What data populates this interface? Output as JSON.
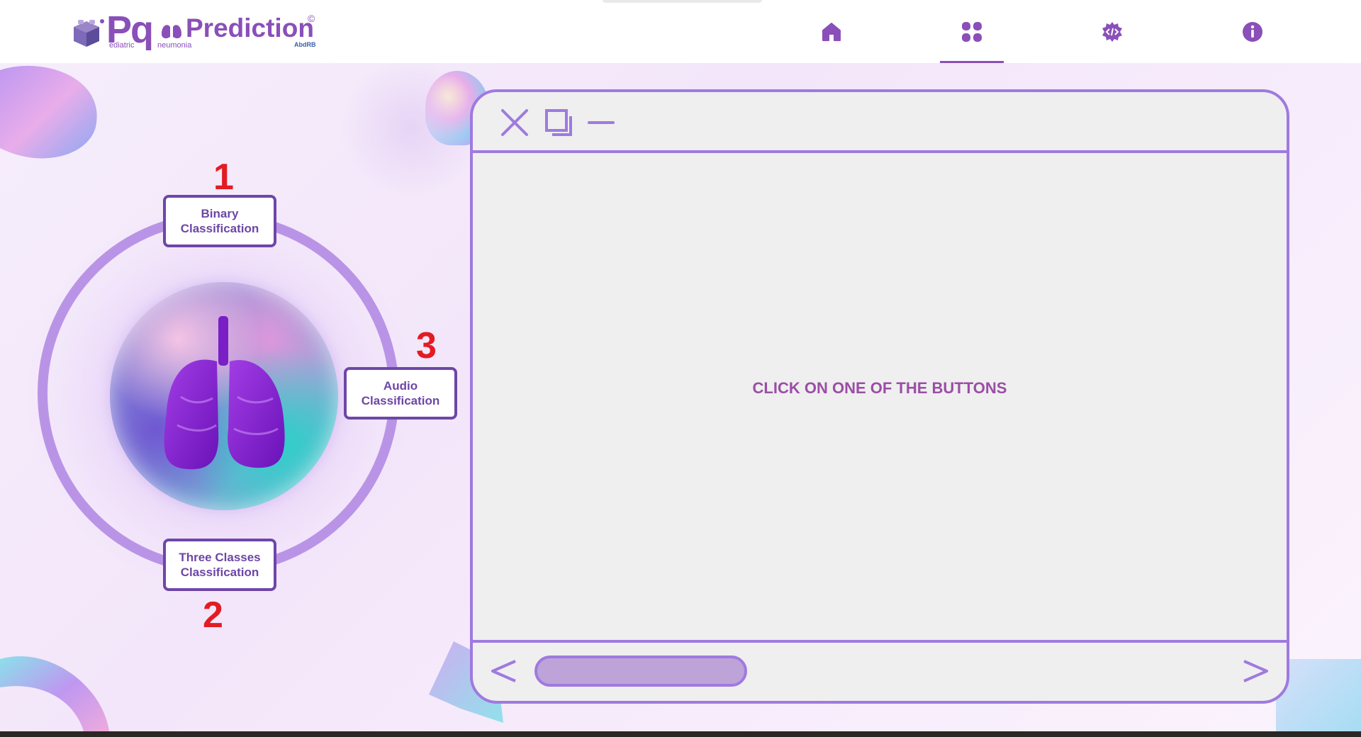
{
  "brand": {
    "pq": "Pq",
    "word": "Prediction",
    "copyright": "©",
    "sub_left": "ediatric",
    "sub_right": "neumonia",
    "maker": "AbdRB"
  },
  "nav": {
    "items": [
      {
        "name": "home",
        "icon": "home-icon"
      },
      {
        "name": "dashboard",
        "icon": "grid-icon",
        "active": true
      },
      {
        "name": "developer",
        "icon": "code-gear-icon"
      },
      {
        "name": "info",
        "icon": "info-icon"
      }
    ]
  },
  "menu": {
    "buttons": [
      {
        "label": "Binary Classification",
        "number": "1"
      },
      {
        "label": "Three Classes Classification",
        "number": "2"
      },
      {
        "label": "Audio Classification",
        "number": "3"
      }
    ]
  },
  "window": {
    "controls": [
      "close-icon",
      "maximize-icon",
      "minimize-icon"
    ],
    "message": "CLICK ON ONE OF THE BUTTONS",
    "footer": {
      "prev": "<",
      "next": ">"
    }
  },
  "colors": {
    "accent": "#8a4fb8",
    "panel_border": "#9f7ae0",
    "number_red": "#e31b23",
    "message": "#9b4ea6"
  }
}
